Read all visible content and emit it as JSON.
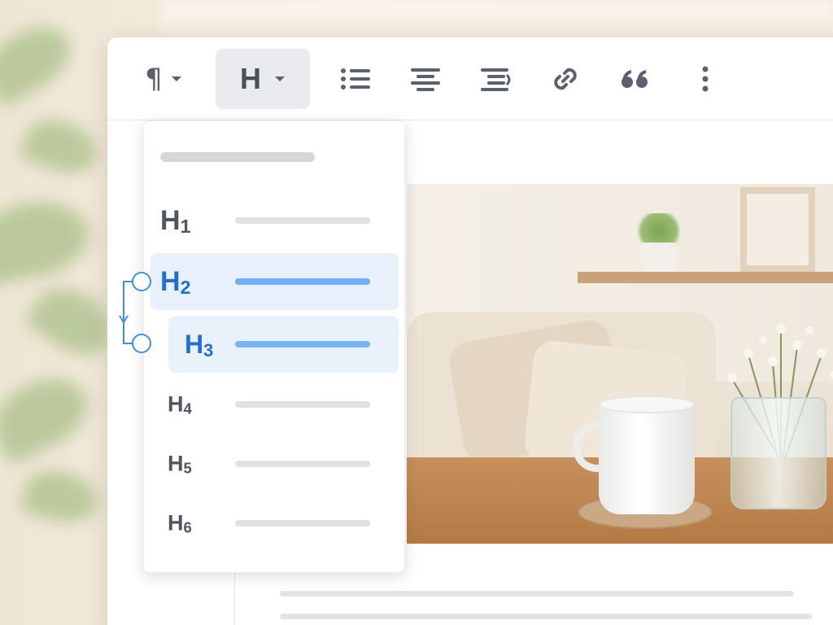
{
  "toolbar": {
    "paragraph": {
      "icon": "pilcrow-icon",
      "glyph": "¶"
    },
    "heading": {
      "icon": "heading-icon",
      "glyph": "H"
    },
    "tools": [
      {
        "name": "bulleted-list",
        "icon": "list-icon"
      },
      {
        "name": "align-center",
        "icon": "align-center-icon"
      },
      {
        "name": "indent",
        "icon": "indent-icon"
      },
      {
        "name": "link",
        "icon": "link-icon"
      },
      {
        "name": "quote",
        "icon": "quote-icon"
      },
      {
        "name": "more",
        "icon": "more-vertical-icon"
      }
    ]
  },
  "heading_menu": {
    "items": [
      {
        "level": "H",
        "num": "1",
        "selected": false
      },
      {
        "level": "H",
        "num": "2",
        "selected": true
      },
      {
        "level": "H",
        "num": "3",
        "selected": true
      },
      {
        "level": "H",
        "num": "4",
        "selected": false
      },
      {
        "level": "H",
        "num": "5",
        "selected": false
      },
      {
        "level": "H",
        "num": "6",
        "selected": false
      }
    ]
  },
  "colors": {
    "accent": "#1f6fd1",
    "selection_bg": "#e7f0fb",
    "toolbar_active_bg": "#e9ebee",
    "icon": "#5b616c"
  }
}
